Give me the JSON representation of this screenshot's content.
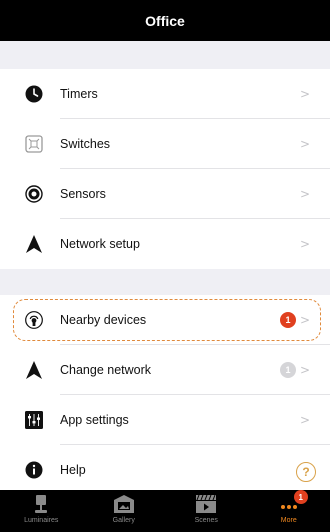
{
  "header": {
    "title": "Office"
  },
  "group1": {
    "items": [
      {
        "label": "Timers"
      },
      {
        "label": "Switches"
      },
      {
        "label": "Sensors"
      },
      {
        "label": "Network setup"
      }
    ]
  },
  "group2": {
    "items": [
      {
        "label": "Nearby devices",
        "badge": "1",
        "badge_color": "#e0401f"
      },
      {
        "label": "Change network",
        "badge": "1",
        "badge_color": "#d5d5d8"
      },
      {
        "label": "App settings"
      },
      {
        "label": "Help"
      }
    ]
  },
  "help_fab": {
    "label": "?"
  },
  "tabbar": {
    "tabs": [
      {
        "label": "Luminaires"
      },
      {
        "label": "Gallery"
      },
      {
        "label": "Scenes"
      },
      {
        "label": "More",
        "badge": "1"
      }
    ],
    "active": "More"
  },
  "colors": {
    "accent": "#f0881f",
    "badge_red": "#e0401f"
  }
}
